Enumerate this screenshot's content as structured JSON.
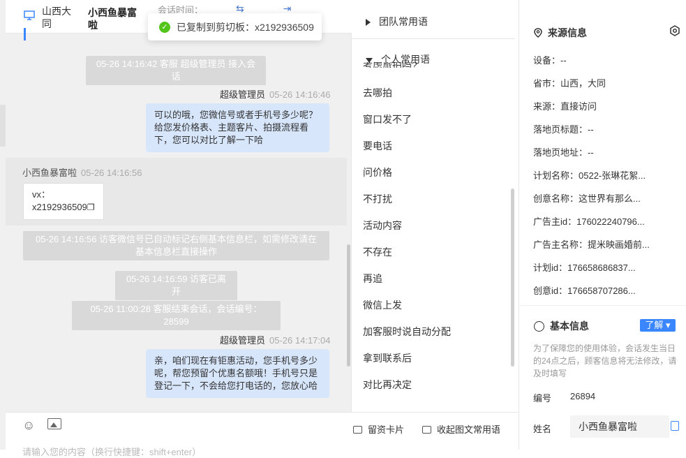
{
  "header": {
    "location": "山西大同",
    "visitor_name": "小西鱼暴富啦",
    "session_time_label": "会话时间："
  },
  "toast": {
    "text": "已复制到剪切板：x2192936509"
  },
  "messages": {
    "sys1": "05-26 14:16:42 客服 超级管理员 接入会话",
    "agent1_name": "超级管理员",
    "agent1_time": "05-26 14:16:46",
    "agent1_text": "可以的哦，您微信号或者手机号多少呢？给您发价格表、主题客片、拍摄流程看下，您可以对比了解一下哈",
    "visitor_name": "小西鱼暴富啦",
    "visitor_time": "05-26 14:16:56",
    "visitor_card": "vx：x2192936509",
    "sys2": "05-26 14:16:56 访客微信号已自动标记右侧基本信息栏，如需修改请在基本信息栏直接操作",
    "sys3": "05-26 14:16:59 访客已离开",
    "sys4": "05-26 11:00:28 客服结束会话，会话编号：28599",
    "agent2_name": "超级管理员",
    "agent2_time": "05-26 14:17:04",
    "agent2_text": "亲，咱们现在有钜惠活动，您手机号多少呢，帮您预留个优惠名额哦！手机号只是登记一下，不会给您打电话的，您放心哈"
  },
  "input": {
    "placeholder": "请输入您的内容（换行快捷键：shift+enter）"
  },
  "phrases": {
    "group_team": "团队常用语",
    "group_personal": "个人常用语",
    "cut_item": "考虑旅拍吗?",
    "items": [
      "去哪拍",
      "窗口发不了",
      "要电话",
      "问价格",
      "不打扰",
      "活动内容",
      "不存在",
      "再追",
      "微信上发",
      "加客服时说自动分配",
      "拿到联系后",
      "对比再决定"
    ],
    "btn_card": "留资卡片",
    "btn_collapse": "收起图文常用语"
  },
  "source_info": {
    "title": "来源信息",
    "rows": [
      "设备：--",
      "省市：山西，大同",
      "来源：直接访问",
      "落地页标题：--",
      "落地页地址：--",
      "计划名称：0522-张琳花絮...",
      "创意名称：这世界有那么...",
      "广告主id：176022240796...",
      "广告主名称：提米映画婚前...",
      "计划id：176658686837...",
      "创意id：176658707286..."
    ]
  },
  "basic_info": {
    "title": "基本信息",
    "learn_more": "了解",
    "note": "为了保障您的使用体验，会话发生当日的24点之后，顾客信息将无法修改，请及时填写",
    "code_label": "编号",
    "code_value": "26894",
    "name_label": "姓名",
    "name_value": "小西鱼暴富啦"
  },
  "colors": {
    "accent": "#3a86ff",
    "bubble": "#d7e6fb",
    "success": "#52c41a"
  }
}
